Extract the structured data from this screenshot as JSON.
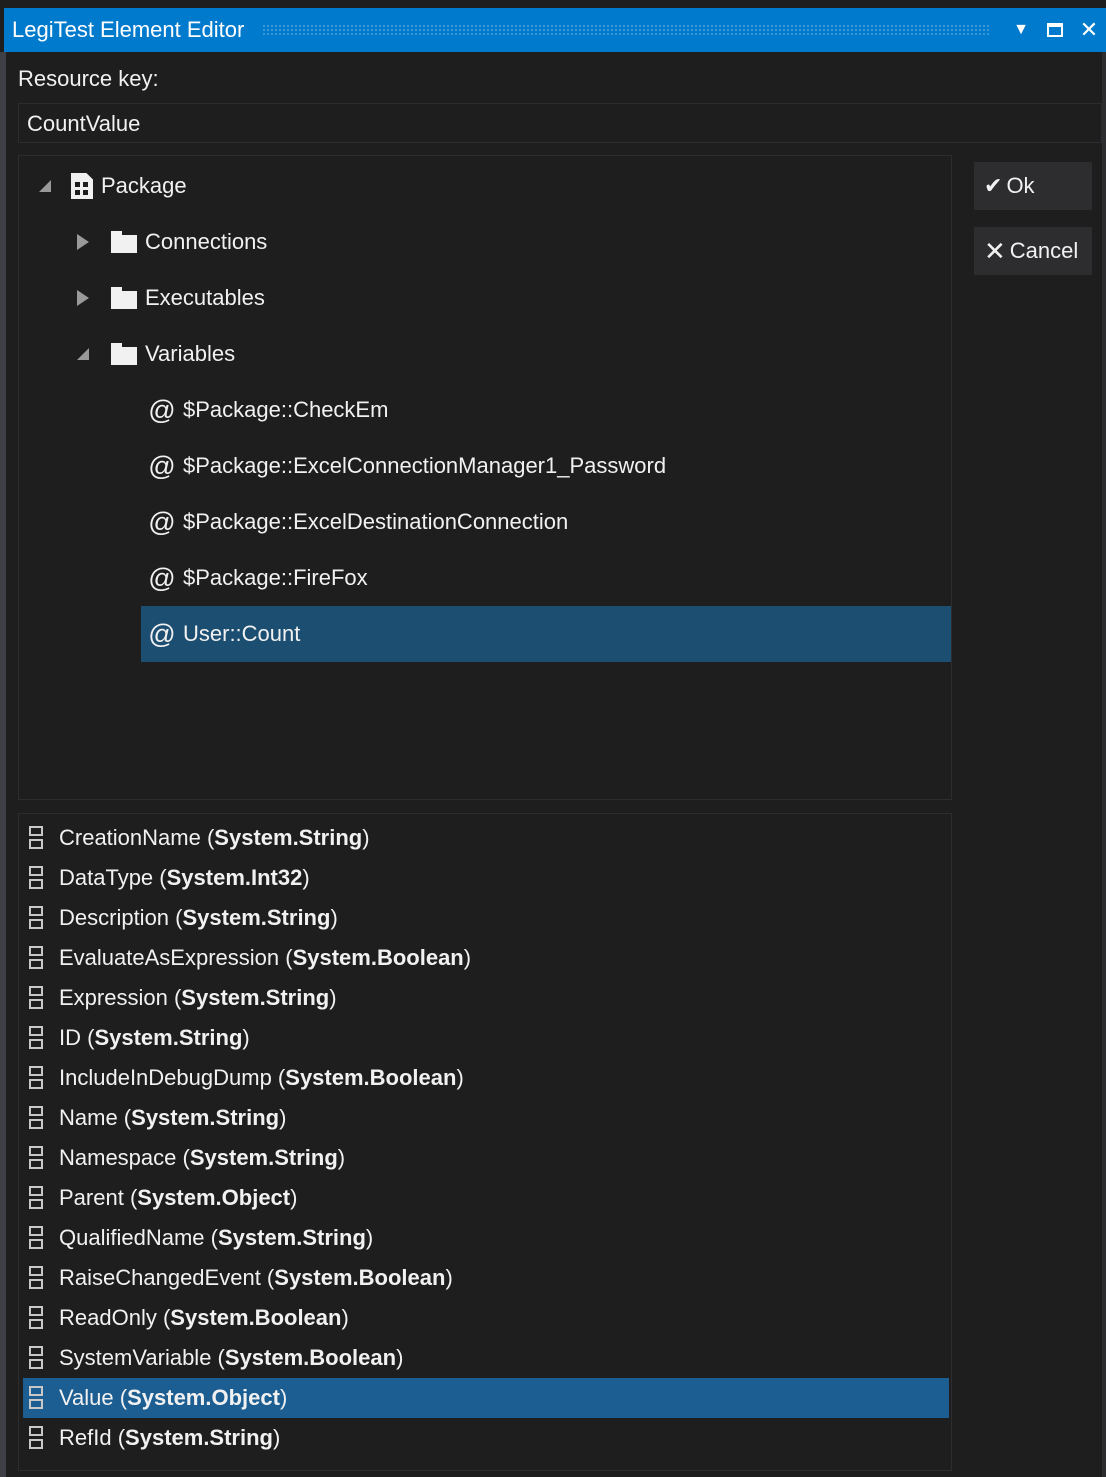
{
  "window": {
    "title": "LegiTest Element Editor",
    "dropdown_glyph": "▼",
    "maximize_glyph": "□",
    "close_glyph": "✕"
  },
  "resource": {
    "label": "Resource key:",
    "value": "CountValue"
  },
  "tree": {
    "root": "Package",
    "folders": [
      "Connections",
      "Executables",
      "Variables"
    ],
    "variables": [
      "$Package::CheckEm",
      "$Package::ExcelConnectionManager1_Password",
      "$Package::ExcelDestinationConnection",
      "$Package::FireFox",
      "User::Count"
    ],
    "selected_variable": "User::Count",
    "at_glyph": "@"
  },
  "buttons": {
    "ok_label": "Ok",
    "ok_glyph": "✔",
    "cancel_label": "Cancel",
    "cancel_glyph": "✕"
  },
  "properties": [
    {
      "name": "CreationName",
      "type": "System.String"
    },
    {
      "name": "DataType",
      "type": "System.Int32"
    },
    {
      "name": "Description",
      "type": "System.String"
    },
    {
      "name": "EvaluateAsExpression",
      "type": "System.Boolean"
    },
    {
      "name": "Expression",
      "type": "System.String"
    },
    {
      "name": "ID",
      "type": "System.String"
    },
    {
      "name": "IncludeInDebugDump",
      "type": "System.Boolean"
    },
    {
      "name": "Name",
      "type": "System.String"
    },
    {
      "name": "Namespace",
      "type": "System.String"
    },
    {
      "name": "Parent",
      "type": "System.Object"
    },
    {
      "name": "QualifiedName",
      "type": "System.String"
    },
    {
      "name": "RaiseChangedEvent",
      "type": "System.Boolean"
    },
    {
      "name": "ReadOnly",
      "type": "System.Boolean"
    },
    {
      "name": "SystemVariable",
      "type": "System.Boolean"
    },
    {
      "name": "Value",
      "type": "System.Object"
    },
    {
      "name": "RefId",
      "type": "System.String"
    }
  ],
  "selected_property": "Value",
  "colors": {
    "titlebar": "#007acc",
    "tree_selection": "#1c4e72",
    "property_selection": "#1c5d92",
    "background": "#1e1e1e"
  }
}
